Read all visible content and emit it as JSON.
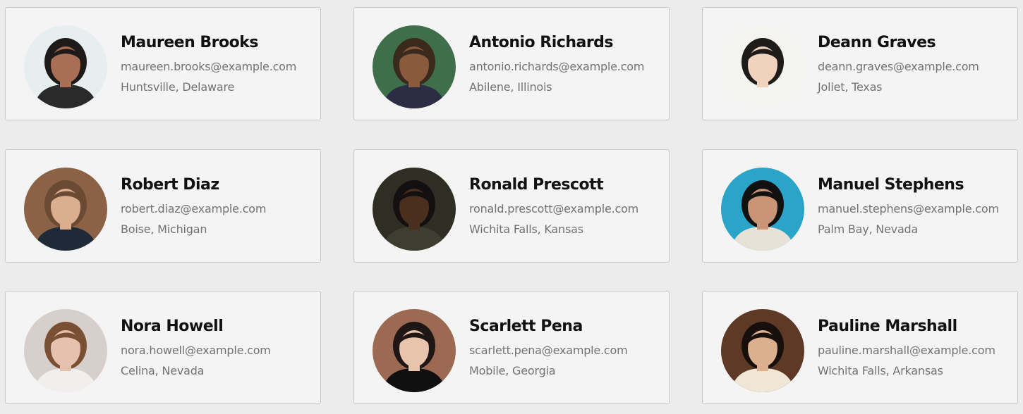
{
  "people": [
    {
      "name": "Maureen Brooks",
      "email": "maureen.brooks@example.com",
      "location": "Huntsville, Delaware",
      "avatar": {
        "bg": "#e6eef0",
        "skin": "#a86f56",
        "hair": "#1f1a1a",
        "shirt": "#2a2a2a"
      }
    },
    {
      "name": "Antonio Richards",
      "email": "antonio.richards@example.com",
      "location": "Abilene, Illinois",
      "avatar": {
        "bg": "#3f6e4a",
        "skin": "#8a5a3c",
        "hair": "#3a2a1e",
        "shirt": "#2c2c44"
      }
    },
    {
      "name": "Deann Graves",
      "email": "deann.graves@example.com",
      "location": "Joliet, Texas",
      "avatar": {
        "bg": "#f3f3f0",
        "skin": "#f0d2bd",
        "hair": "#1e1b1b",
        "shirt": "#f4f4f2"
      }
    },
    {
      "name": "Robert Diaz",
      "email": "robert.diaz@example.com",
      "location": "Boise, Michigan",
      "avatar": {
        "bg": "#8b6245",
        "skin": "#dcae90",
        "hair": "#6a4a33",
        "shirt": "#1e2a38"
      }
    },
    {
      "name": "Ronald Prescott",
      "email": "ronald.prescott@example.com",
      "location": "Wichita Falls, Kansas",
      "avatar": {
        "bg": "#2e2e24",
        "skin": "#4a2e1e",
        "hair": "#121010",
        "shirt": "#3d3d30"
      }
    },
    {
      "name": "Manuel Stephens",
      "email": "manuel.stephens@example.com",
      "location": "Palm Bay, Nevada",
      "avatar": {
        "bg": "#2aa4c8",
        "skin": "#c99576",
        "hair": "#111111",
        "shirt": "#e8e2d6"
      }
    },
    {
      "name": "Nora Howell",
      "email": "nora.howell@example.com",
      "location": "Celina, Nevada",
      "avatar": {
        "bg": "#d6cfcc",
        "skin": "#e6c2ae",
        "hair": "#7a5034",
        "shirt": "#f2eeee"
      }
    },
    {
      "name": "Scarlett Pena",
      "email": "scarlett.pena@example.com",
      "location": "Mobile, Georgia",
      "avatar": {
        "bg": "#9c6a52",
        "skin": "#e9c4ad",
        "hair": "#1e1715",
        "shirt": "#101010"
      }
    },
    {
      "name": "Pauline Marshall",
      "email": "pauline.marshall@example.com",
      "location": "Wichita Falls, Arkansas",
      "avatar": {
        "bg": "#5e3a26",
        "skin": "#ddb08d",
        "hair": "#170f0c",
        "shirt": "#efe6d6"
      }
    }
  ]
}
